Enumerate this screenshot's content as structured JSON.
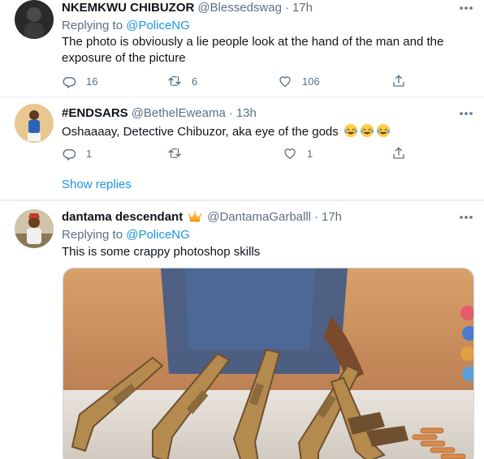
{
  "tweets": [
    {
      "name": "NKEMKWU CHIBUZOR",
      "handle": "@Blessedswag",
      "time": "17h",
      "reply_prefix": "Replying to",
      "reply_to": "@PoliceNG",
      "text": "The photo is obviously a lie people look at the hand of the man and the exposure of the picture",
      "counts": {
        "replies": "16",
        "retweets": "6",
        "likes": "106"
      }
    },
    {
      "name": "#ENDSARS",
      "handle": "@BethelEweama",
      "time": "13h",
      "text": "Oshaaaay, Detective Chibuzor, aka eye of the gods",
      "counts": {
        "replies": "1",
        "retweets": "",
        "likes": "1"
      },
      "show_replies": "Show replies"
    },
    {
      "name": "dantama descendant",
      "badge_icon": "crown-emoji",
      "handle": "@DantamaGarballl",
      "time": "17h",
      "reply_prefix": "Replying to",
      "reply_to": "@PoliceNG",
      "text": "This is some crappy photoshop skills",
      "media_description_icon": "photo-of-rifles"
    }
  ],
  "colors": {
    "link": "#1b95e0",
    "muted": "#5b7083",
    "divider": "#ebeef0"
  },
  "dot": "·"
}
